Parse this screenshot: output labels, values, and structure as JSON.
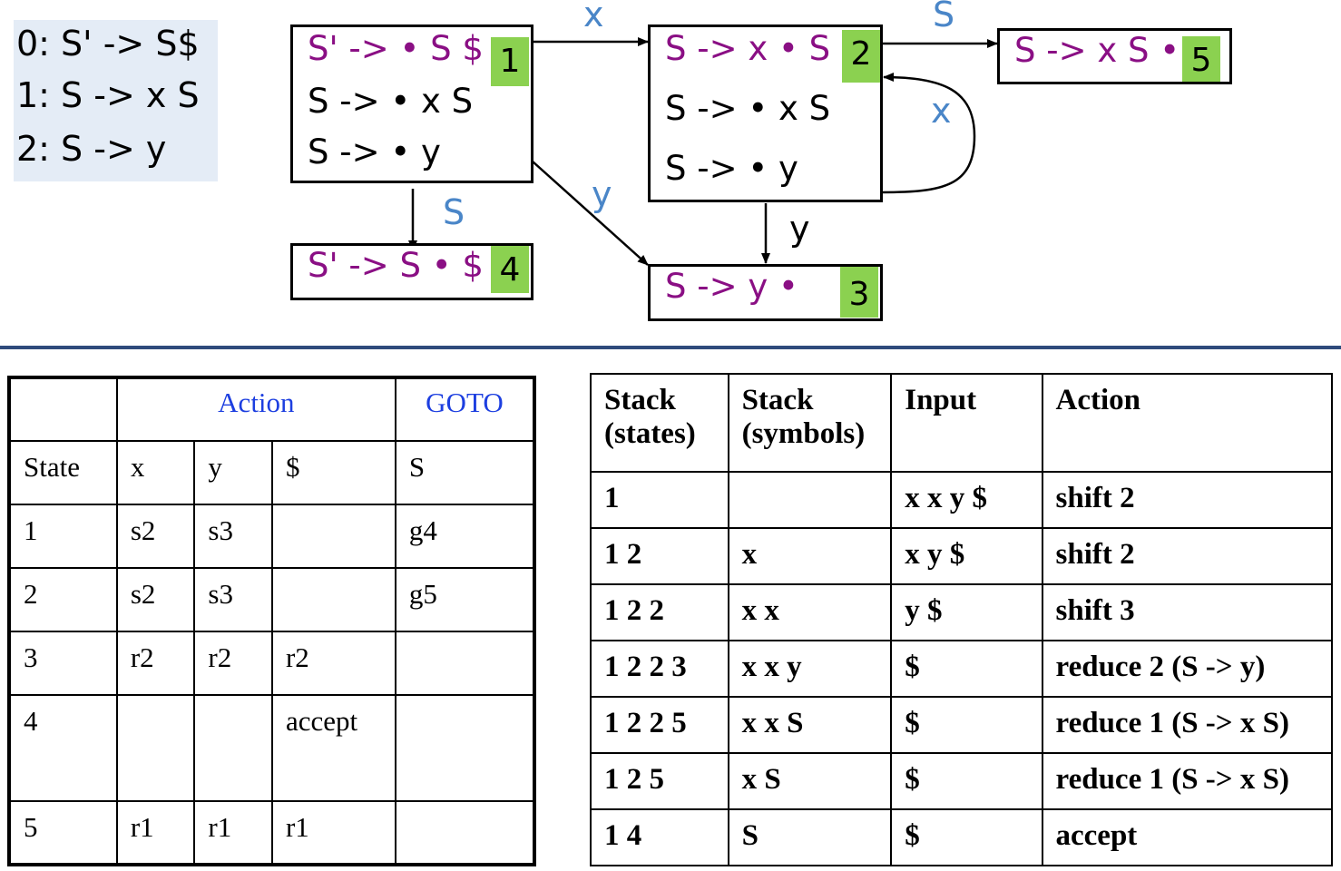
{
  "grammar": {
    "rules": [
      "0: S' -> S$",
      "1: S -> x S",
      "2: S -> y"
    ]
  },
  "states": {
    "s1": {
      "number": "1",
      "items": [
        "S' -> • S $",
        "S -> • x S",
        "S -> • y"
      ]
    },
    "s2": {
      "number": "2",
      "items": [
        "S -> x • S",
        "S -> • x S",
        "S -> • y"
      ]
    },
    "s3": {
      "number": "3",
      "items": [
        "S -> y •"
      ]
    },
    "s4": {
      "number": "4",
      "items": [
        "S' -> S • $"
      ]
    },
    "s5": {
      "number": "5",
      "items": [
        "S -> x S •"
      ]
    }
  },
  "transitions": {
    "s1_s2": "x",
    "s2_s5": "S",
    "s2_s2": "x",
    "s1_s4": "S",
    "s1_s3": "y",
    "s2_s3": "y"
  },
  "colors": {
    "kernel_item": "#8a0f84",
    "state_badge": "#8bd150",
    "edge_label": "#4a86c8",
    "table_header": "#1d3fe0",
    "divider": "#2f4b7c",
    "grammar_bg": "#e4ecf6"
  },
  "parse_table": {
    "group_headers": {
      "action": "Action",
      "goto": "GOTO"
    },
    "columns": [
      "State",
      "x",
      "y",
      "$",
      "S"
    ],
    "rows": [
      [
        "1",
        "s2",
        "s3",
        "",
        "g4"
      ],
      [
        "2",
        "s2",
        "s3",
        "",
        "g5"
      ],
      [
        "3",
        "r2",
        "r2",
        "r2",
        ""
      ],
      [
        "4",
        "",
        "",
        "accept",
        ""
      ],
      [
        "5",
        "r1",
        "r1",
        "r1",
        ""
      ]
    ]
  },
  "trace_table": {
    "headers": {
      "states": [
        "Stack",
        "(states)"
      ],
      "symbols": [
        "Stack",
        "(symbols)"
      ],
      "input": "Input",
      "action": "Action"
    },
    "rows": [
      [
        "1",
        "",
        "x x y $",
        "shift 2"
      ],
      [
        "1 2",
        "x",
        "x y $",
        "shift 2"
      ],
      [
        "1 2 2",
        "x x",
        "y $",
        "shift 3"
      ],
      [
        "1 2 2 3",
        "x x y",
        "$",
        "reduce 2 (S -> y)"
      ],
      [
        "1 2 2 5",
        "x x S",
        "$",
        "reduce 1 (S -> x S)"
      ],
      [
        "1 2 5",
        "x S",
        "$",
        "reduce 1 (S -> x S)"
      ],
      [
        "1 4",
        "S",
        "$",
        "accept"
      ]
    ]
  }
}
